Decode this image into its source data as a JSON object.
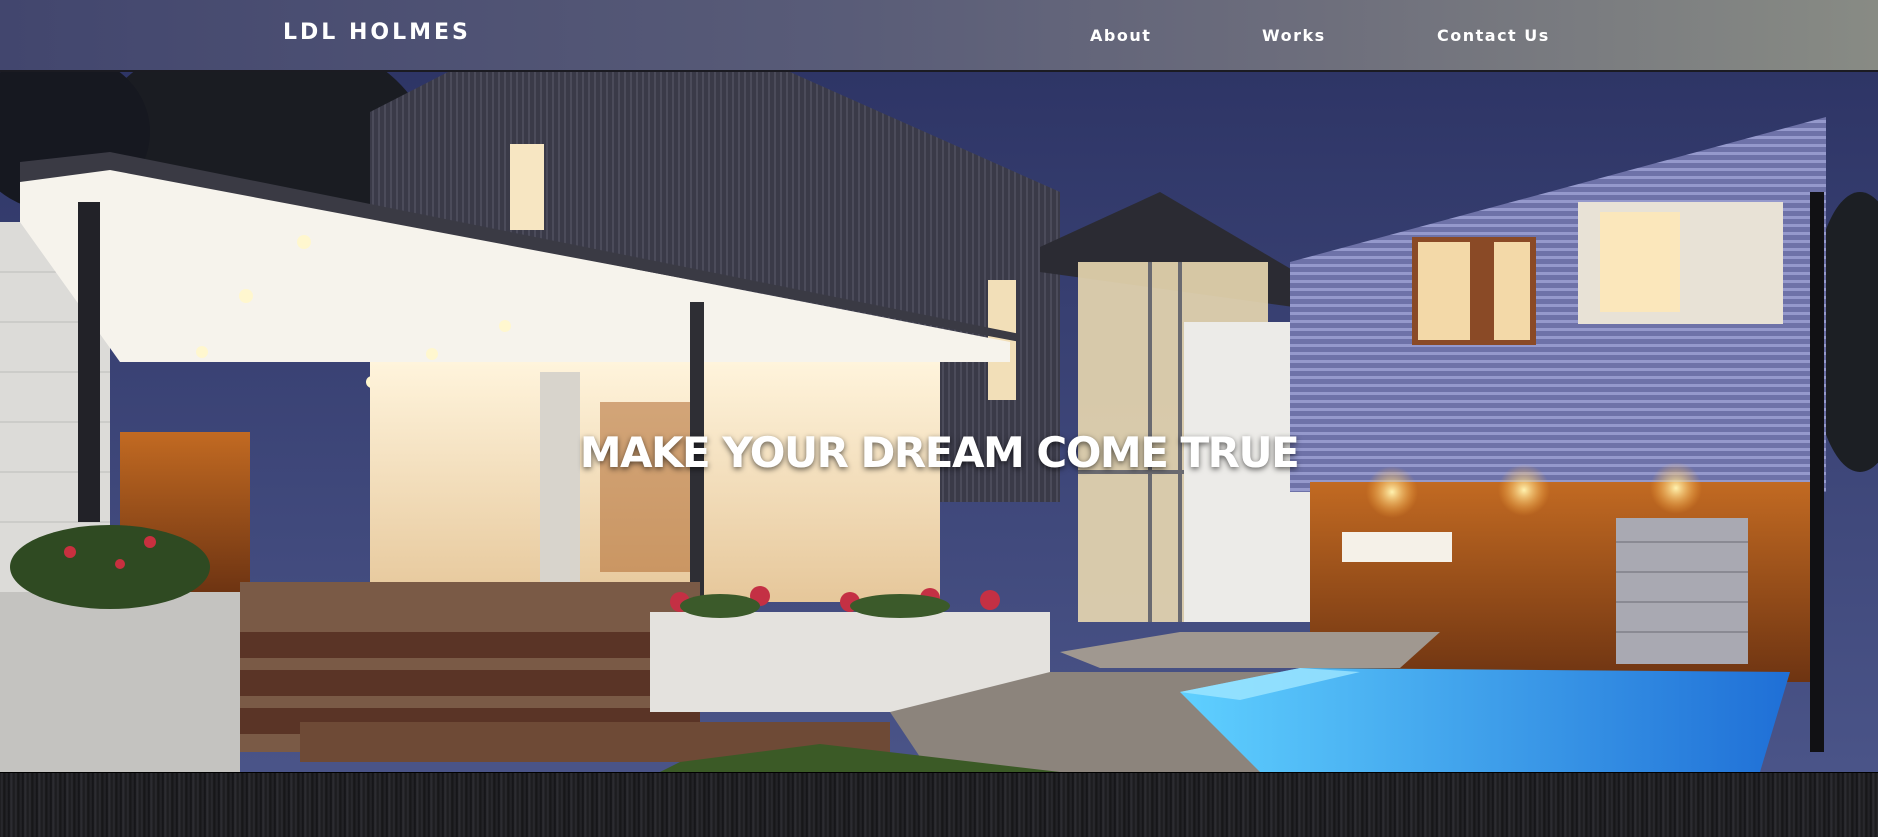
{
  "header": {
    "logo": "LDL HOLMES",
    "nav": [
      "About",
      "Works",
      "Contact Us"
    ]
  },
  "hero": {
    "title": "MAKE YOUR DREAM COME TRUE",
    "image": "modern-house-night-photo"
  },
  "colors": {
    "header_left": "#42466e",
    "header_right": "#888b84",
    "sky": "#3c4272",
    "pool": "#3aa8f0",
    "wood": "#a5531f"
  }
}
